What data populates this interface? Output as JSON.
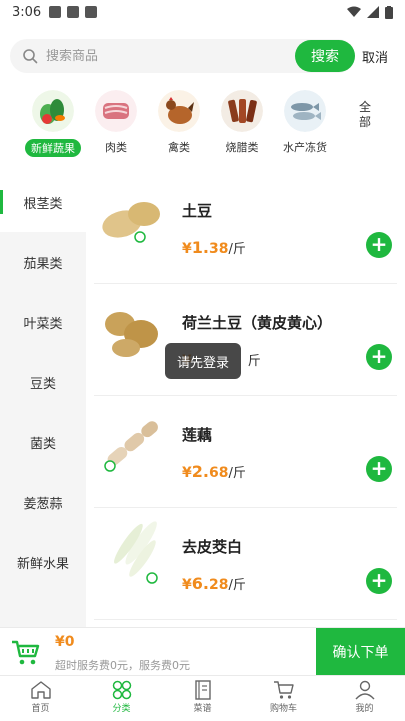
{
  "status_bar": {
    "time": "3:06"
  },
  "search": {
    "placeholder": "搜索商品",
    "button_label": "搜索",
    "cancel_label": "取消"
  },
  "categories": [
    {
      "label": "新鲜蔬果",
      "icon": "vegetables-icon",
      "active": true
    },
    {
      "label": "肉类",
      "icon": "meat-icon"
    },
    {
      "label": "禽类",
      "icon": "poultry-icon"
    },
    {
      "label": "烧腊类",
      "icon": "roast-meat-icon"
    },
    {
      "label": "水产冻货",
      "icon": "seafood-icon"
    }
  ],
  "category_more_label": "全部",
  "sidebar": {
    "items": [
      {
        "label": "根茎类",
        "active": true
      },
      {
        "label": "茄果类"
      },
      {
        "label": "叶菜类"
      },
      {
        "label": "豆类"
      },
      {
        "label": "菌类"
      },
      {
        "label": "姜葱蒜"
      },
      {
        "label": "新鲜水果"
      }
    ]
  },
  "products": [
    {
      "name": "土豆",
      "currency": "¥",
      "price_int": "1.",
      "price_dec": "38",
      "unit": "/斤",
      "image": "potato-icon"
    },
    {
      "name": "荷兰土豆（黄皮黄心）",
      "currency": "¥",
      "price_int": "",
      "price_dec": "",
      "unit": "斤",
      "image": "potato-icon"
    },
    {
      "name": "莲藕",
      "currency": "¥",
      "price_int": "2.",
      "price_dec": "68",
      "unit": "/斤",
      "image": "lotus-root-icon"
    },
    {
      "name": "去皮茭白",
      "currency": "¥",
      "price_int": "6.",
      "price_dec": "28",
      "unit": "/斤",
      "image": "wild-rice-stem-icon"
    }
  ],
  "toast": "请先登录",
  "cart": {
    "total": "¥0",
    "note": "超时服务费0元，服务费0元",
    "confirm_label": "确认下单"
  },
  "tabbar": [
    {
      "label": "首页",
      "icon": "home-icon"
    },
    {
      "label": "分类",
      "icon": "category-icon",
      "active": true
    },
    {
      "label": "菜谱",
      "icon": "recipe-icon"
    },
    {
      "label": "购物车",
      "icon": "cart-icon"
    },
    {
      "label": "我的",
      "icon": "user-icon"
    }
  ],
  "colors": {
    "accent": "#1fb83f",
    "price": "#f08b1d",
    "sidebar_bg": "#f5f5f5"
  }
}
